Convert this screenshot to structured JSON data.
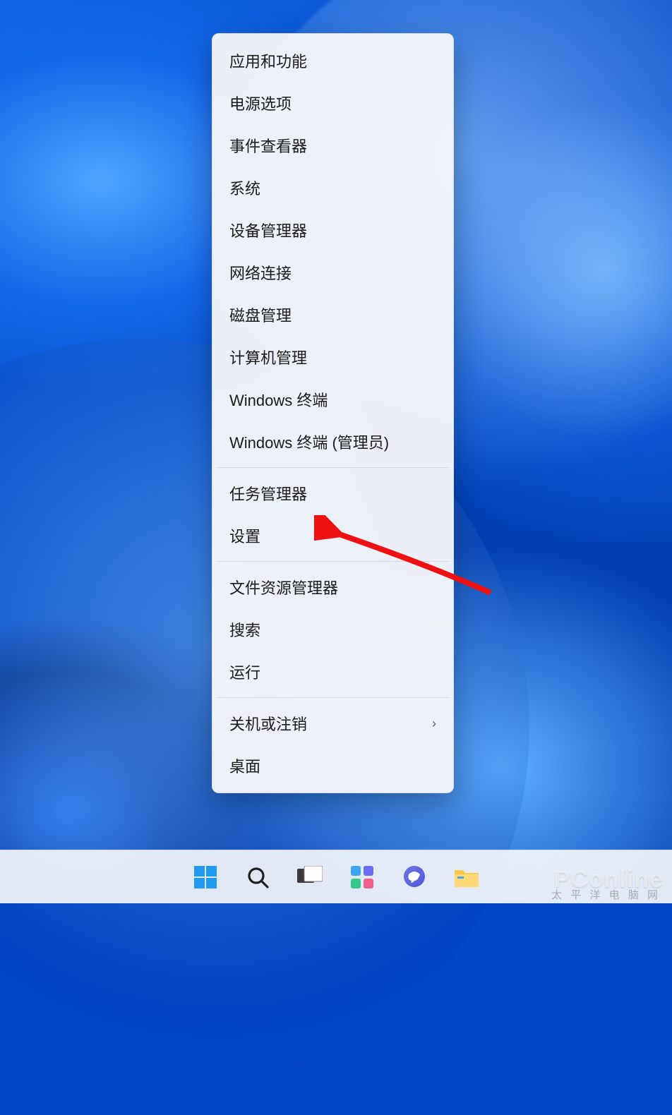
{
  "contextMenu": {
    "groups": [
      [
        "应用和功能",
        "电源选项",
        "事件查看器",
        "系统",
        "设备管理器",
        "网络连接",
        "磁盘管理",
        "计算机管理",
        "Windows 终端",
        "Windows 终端 (管理员)"
      ],
      [
        "任务管理器",
        "设置"
      ],
      [
        "文件资源管理器",
        "搜索",
        "运行"
      ],
      [
        {
          "label": "关机或注销",
          "submenu": true
        },
        "桌面"
      ]
    ]
  },
  "taskbar": {
    "icons": [
      "start",
      "search",
      "task-view",
      "widgets",
      "chat",
      "file-explorer"
    ]
  },
  "watermark": {
    "brand": "PConline",
    "sub": "太 平 洋 电 脑 网"
  }
}
